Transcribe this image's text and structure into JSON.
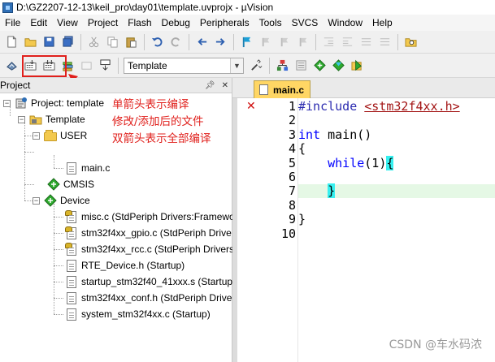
{
  "window": {
    "title": "D:\\GZ2207-12-13\\keil_pro\\day01\\template.uvprojx - µVision"
  },
  "menu": [
    {
      "label": "File"
    },
    {
      "label": "Edit"
    },
    {
      "label": "View"
    },
    {
      "label": "Project"
    },
    {
      "label": "Flash"
    },
    {
      "label": "Debug"
    },
    {
      "label": "Peripherals"
    },
    {
      "label": "Tools"
    },
    {
      "label": "SVCS"
    },
    {
      "label": "Window"
    },
    {
      "label": "Help"
    }
  ],
  "toolbar2": {
    "target_select": "Template"
  },
  "project_panel": {
    "title": "Project",
    "tree": {
      "root": "Project: template",
      "target": "Template",
      "user_group": "USER",
      "user_files": [
        "main.c"
      ],
      "cmsis": "CMSIS",
      "device_group": "Device",
      "device_files": [
        "misc.c (StdPeriph Drivers:Framewo",
        "stm32f4xx_gpio.c (StdPeriph Drive",
        "stm32f4xx_rcc.c (StdPeriph Drivers",
        "RTE_Device.h (Startup)",
        "startup_stm32f40_41xxx.s (Startup",
        "stm32f4xx_conf.h (StdPeriph Drive",
        "system_stm32f4xx.c (Startup)"
      ]
    }
  },
  "annotation": {
    "lines": [
      "单箭头表示编译",
      "修改/添加后的文件",
      "双箭头表示全部编译"
    ],
    "color": "#e0201c"
  },
  "editor": {
    "tab_label": "main.c",
    "line_numbers": [
      "1",
      "2",
      "3",
      "4",
      "5",
      "6",
      "7",
      "8",
      "9",
      "10"
    ],
    "code": {
      "l1_directive": "#include",
      "l1_header": "<stm32f4xx.h>",
      "l3_type": "int",
      "l3_rest": " main()",
      "l4": "{",
      "l5_keyword": "while",
      "l5_rest": "(1)",
      "l5_brace": "{",
      "l7_brace": "}",
      "l9": "}"
    },
    "breakpoint_mark": "✕",
    "current_line": 7
  },
  "watermark": "CSDN @车水码浓",
  "colors": {
    "accent_red": "#e0201c",
    "tab_yellow": "#ffd664",
    "current_line_bg": "#e5f8e5",
    "brace_highlight": "#36f0f0"
  },
  "icons": {
    "toolbar1": [
      "new-file-icon",
      "open-folder-icon",
      "save-icon",
      "save-all-icon",
      "cut-icon",
      "copy-icon",
      "paste-icon",
      "undo-icon",
      "redo-icon",
      "nav-back-icon",
      "nav-forward-icon",
      "bookmark-icon",
      "prev-bookmark-icon",
      "next-bookmark-icon",
      "clear-bookmarks-icon",
      "indent-icon",
      "unindent-icon",
      "comment-icon",
      "uncomment-icon",
      "find-in-files-icon"
    ],
    "toolbar2": [
      "translate-icon",
      "build-icon",
      "rebuild-icon",
      "batch-build-icon",
      "stop-build-icon",
      "download-icon",
      "target-options-icon",
      "manage-project-items-icon",
      "select-packs-icon",
      "pack-installer-icon",
      "rte-manage-icon",
      "rte-device-icon"
    ]
  }
}
